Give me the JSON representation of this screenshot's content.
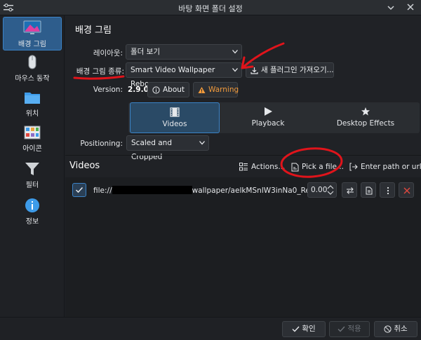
{
  "window": {
    "title": "바탕 화면 폴더 설정",
    "menu_icon": "window-menu-icon",
    "chevron_icon": "chevron-down-icon",
    "close_icon": "close-icon"
  },
  "sidebar": {
    "items": [
      {
        "label": "배경 그림",
        "icon": "wallpaper-icon",
        "active": true
      },
      {
        "label": "마우스 동작",
        "icon": "mouse-icon"
      },
      {
        "label": "위치",
        "icon": "folder-icon"
      },
      {
        "label": "아이콘",
        "icon": "icons-grid-icon"
      },
      {
        "label": "필터",
        "icon": "filter-icon"
      },
      {
        "label": "정보",
        "icon": "info-icon"
      }
    ]
  },
  "main": {
    "heading": "배경 그림",
    "layout_label": "레이아웃:",
    "layout_value": "폴더 보기",
    "wallpaper_type_label": "배경 그림 종류:",
    "wallpaper_type_value": "Smart Video Wallpaper Reborn",
    "get_plugins_label": "새 플러그인 가져오기...",
    "version_label": "Version:",
    "version_value": "2.9.0",
    "about_label": "About",
    "warning_label": "Warning",
    "tabs": [
      {
        "label": "Videos",
        "icon": "film-icon",
        "active": true
      },
      {
        "label": "Playback",
        "icon": "play-icon"
      },
      {
        "label": "Desktop Effects",
        "icon": "star-icon"
      }
    ],
    "positioning_label": "Positioning:",
    "positioning_value": "Scaled and Cropped"
  },
  "videos": {
    "title": "Videos",
    "actions_label": "Actions...",
    "pick_file_label": "Pick a file...",
    "enter_path_label": "Enter path or url",
    "rows": [
      {
        "path_prefix": "file://",
        "path_suffix": "wallpaper/aelkMSnlW3inNa0_Relax...",
        "value": "0.00"
      }
    ]
  },
  "footer": {
    "ok_label": "확인",
    "apply_label": "적용",
    "cancel_label": "취소"
  },
  "colors": {
    "accent": "#3b83c7",
    "warning": "#f29b3c",
    "annotation_red": "#e0141b",
    "background": "#1f2125"
  }
}
